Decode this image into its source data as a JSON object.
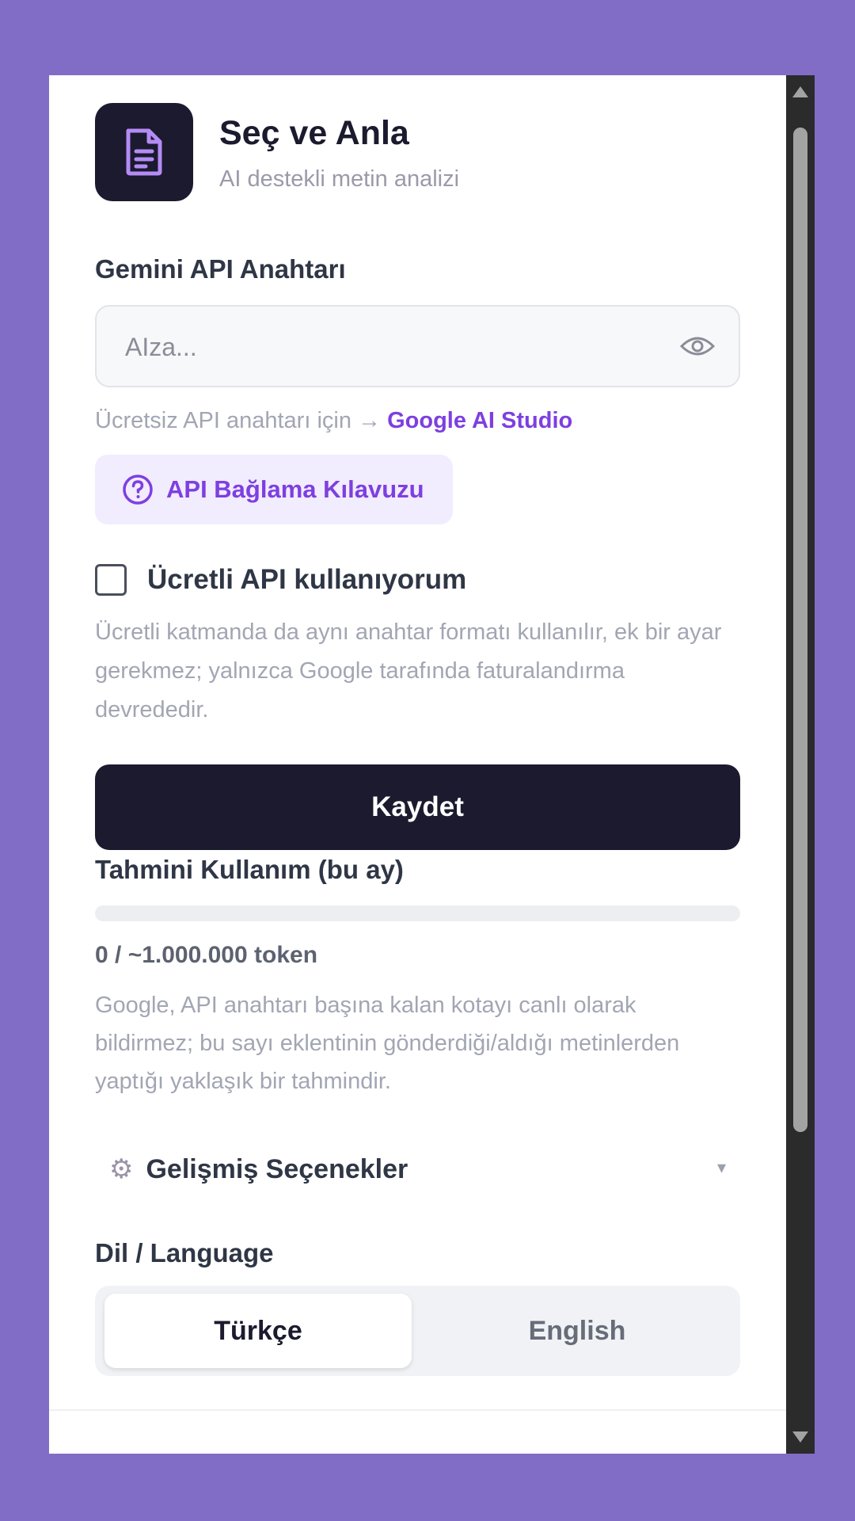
{
  "header": {
    "title": "Seç ve Anla",
    "subtitle": "AI destekli metin analizi",
    "logo_icon": "document-icon"
  },
  "api_key": {
    "label": "Gemini API Anahtarı",
    "placeholder": "AIza...",
    "value": "",
    "toggle_icon": "eye-icon",
    "hint_prefix": "Ücretsiz API anahtarı için →",
    "hint_link": "Google AI Studio"
  },
  "guide_button": {
    "label": "API Bağlama Kılavuzu",
    "icon": "question-circle-icon"
  },
  "paid_api": {
    "label": "Ücretli API kullanıyorum",
    "checked": false,
    "description": "Ücretli katmanda da aynı anahtar formatı kullanılır, ek bir ayar gerekmez; yalnızca Google tarafında faturalandırma devrededir."
  },
  "save_button": {
    "label": "Kaydet"
  },
  "usage": {
    "title": "Tahmini Kullanım (bu ay)",
    "progress_fraction": 0,
    "count_text": "0 / ~1.000.000 token",
    "note": "Google, API anahtarı başına kalan kotayı canlı olarak bildirmez; bu sayı eklentinin gönderdiği/aldığı metinlerden yaptığı yaklaşık bir tahmindir."
  },
  "advanced": {
    "label": "Gelişmiş Seçenekler",
    "icon": "gear-icon",
    "caret": "▾"
  },
  "language": {
    "label": "Dil / Language",
    "options": [
      "Türkçe",
      "English"
    ],
    "selected": "Türkçe"
  },
  "colors": {
    "background": "#826dc6",
    "accent": "#7e3fe0",
    "dark": "#1b1a2e"
  }
}
